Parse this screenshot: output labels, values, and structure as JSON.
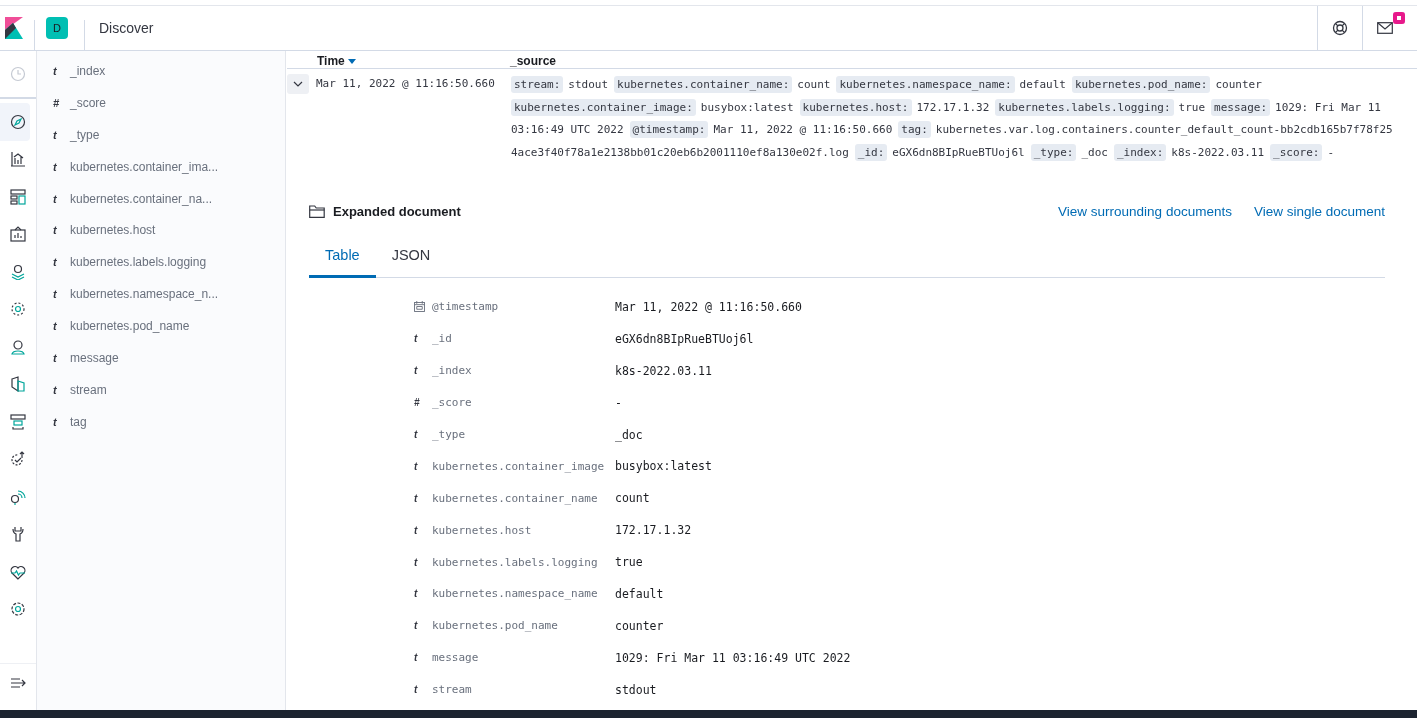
{
  "header": {
    "space_initial": "D",
    "title": "Discover",
    "mail_badge": true
  },
  "nav_icons": [
    {
      "kind": "clock",
      "selected": false
    },
    {
      "kind": "compass",
      "selected": true
    },
    {
      "kind": "chart",
      "selected": false
    },
    {
      "kind": "dashboard",
      "selected": false
    },
    {
      "kind": "canvas",
      "selected": false
    },
    {
      "kind": "map",
      "selected": false
    },
    {
      "kind": "ml",
      "selected": false
    },
    {
      "kind": "user",
      "selected": false
    },
    {
      "kind": "shield",
      "selected": false
    },
    {
      "kind": "logs",
      "selected": false
    },
    {
      "kind": "uptime",
      "selected": false
    },
    {
      "kind": "signal",
      "selected": false
    },
    {
      "kind": "wrench",
      "selected": false
    },
    {
      "kind": "heart",
      "selected": false
    },
    {
      "kind": "gear",
      "selected": false
    }
  ],
  "field_list": [
    {
      "type": "t",
      "name": "_index"
    },
    {
      "type": "#",
      "name": "_score"
    },
    {
      "type": "t",
      "name": "_type"
    },
    {
      "type": "t",
      "name": "kubernetes.container_ima..."
    },
    {
      "type": "t",
      "name": "kubernetes.container_na..."
    },
    {
      "type": "t",
      "name": "kubernetes.host"
    },
    {
      "type": "t",
      "name": "kubernetes.labels.logging"
    },
    {
      "type": "t",
      "name": "kubernetes.namespace_n..."
    },
    {
      "type": "t",
      "name": "kubernetes.pod_name"
    },
    {
      "type": "t",
      "name": "message"
    },
    {
      "type": "t",
      "name": "stream"
    },
    {
      "type": "t",
      "name": "tag"
    }
  ],
  "table": {
    "columns": [
      "Time",
      "_source"
    ],
    "row": {
      "expanded": true,
      "time": "Mar 11, 2022 @ 11:16:50.660",
      "source": [
        {
          "key": "stream:",
          "value": "stdout"
        },
        {
          "key": "kubernetes.container_name:",
          "value": "count"
        },
        {
          "key": "kubernetes.namespace_name:",
          "value": "default"
        },
        {
          "key": "kubernetes.pod_name:",
          "value": "counter"
        },
        {
          "key": "kubernetes.container_image:",
          "value": "busybox:latest"
        },
        {
          "key": "kubernetes.host:",
          "value": "172.17.1.32"
        },
        {
          "key": "kubernetes.labels.logging:",
          "value": "true"
        },
        {
          "key": "message:",
          "value": "1029: Fri Mar 11 03:16:49 UTC 2022"
        },
        {
          "key": "@timestamp:",
          "value": "Mar 11, 2022 @ 11:16:50.660"
        },
        {
          "key": "tag:",
          "value": "kubernetes.var.log.containers.counter_default_count-bb2cdb165b7f78f254ace3f40f78a1e2138bb01c20eb6b2001110ef8a130e02f.log"
        },
        {
          "key": "_id:",
          "value": "eGX6dn8BIpRueBTUoj6l"
        },
        {
          "key": "_type:",
          "value": "_doc"
        },
        {
          "key": "_index:",
          "value": "k8s-2022.03.11"
        },
        {
          "key": "_score:",
          "value": "-"
        }
      ]
    }
  },
  "expanded_document": {
    "title": "Expanded document",
    "links": [
      "View surrounding documents",
      "View single document"
    ],
    "tabs": [
      {
        "label": "Table",
        "selected": true
      },
      {
        "label": "JSON",
        "selected": false
      }
    ],
    "fields": [
      {
        "kind": "date",
        "name": "@timestamp",
        "value": "Mar 11, 2022 @ 11:16:50.660"
      },
      {
        "kind": "field",
        "type": "t",
        "name": "_id",
        "value": "eGX6dn8BIpRueBTUoj6l"
      },
      {
        "kind": "field",
        "type": "t",
        "name": "_index",
        "value": "k8s-2022.03.11"
      },
      {
        "kind": "field",
        "type": "#",
        "name": "_score",
        "value": "-"
      },
      {
        "kind": "field",
        "type": "t",
        "name": "_type",
        "value": "_doc"
      },
      {
        "kind": "field",
        "type": "t",
        "name": "kubernetes.container_image",
        "value": "busybox:latest"
      },
      {
        "kind": "field",
        "type": "t",
        "name": "kubernetes.container_name",
        "value": "count"
      },
      {
        "kind": "field",
        "type": "t",
        "name": "kubernetes.host",
        "value": "172.17.1.32"
      },
      {
        "kind": "field",
        "type": "t",
        "name": "kubernetes.labels.logging",
        "value": "true"
      },
      {
        "kind": "field",
        "type": "t",
        "name": "kubernetes.namespace_name",
        "value": "default"
      },
      {
        "kind": "field",
        "type": "t",
        "name": "kubernetes.pod_name",
        "value": "counter"
      },
      {
        "kind": "field",
        "type": "t",
        "name": "message",
        "value": "1029: Fri Mar 11 03:16:49 UTC 2022"
      },
      {
        "kind": "field",
        "type": "t",
        "name": "stream",
        "value": "stdout"
      }
    ]
  }
}
